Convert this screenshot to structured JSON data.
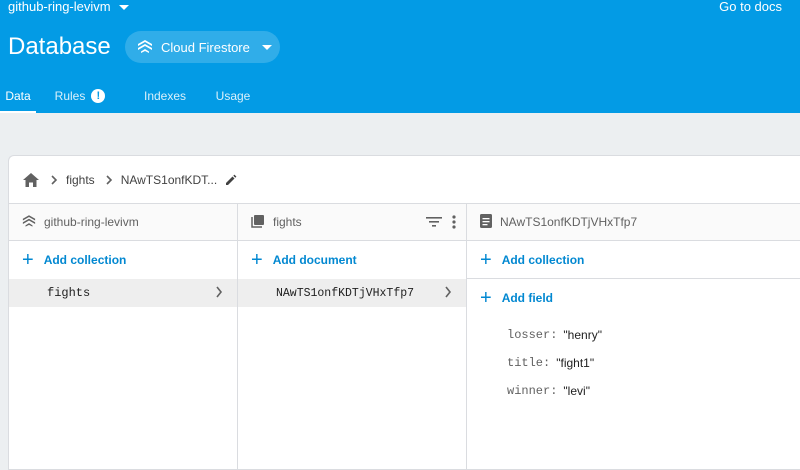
{
  "header": {
    "project_name": "github-ring-levivm",
    "docs_link": "Go to docs",
    "title": "Database",
    "db_selector": "Cloud Firestore"
  },
  "tabs": [
    {
      "label": "Data",
      "active": true
    },
    {
      "label": "Rules",
      "active": false,
      "badge": "!"
    },
    {
      "label": "Indexes",
      "active": false
    },
    {
      "label": "Usage",
      "active": false
    }
  ],
  "breadcrumb": {
    "items": [
      "fights",
      "NAwTS1onfKDT..."
    ]
  },
  "columns": {
    "root": {
      "title": "github-ring-levivm",
      "add_label": "Add collection",
      "items": [
        {
          "label": "fights",
          "selected": true
        }
      ]
    },
    "collection": {
      "title": "fights",
      "add_label": "Add document",
      "items": [
        {
          "label": "NAwTS1onfKDTjVHxTfp7",
          "selected": true
        }
      ]
    },
    "document": {
      "title": "NAwTS1onfKDTjVHxTfp7",
      "add_collection_label": "Add collection",
      "add_field_label": "Add field",
      "fields": [
        {
          "name": "losser:",
          "value": "\"henry\""
        },
        {
          "name": "title:",
          "value": "\"fight1\""
        },
        {
          "name": "winner:",
          "value": "\"levi\""
        }
      ]
    }
  },
  "colors": {
    "header_bg": "#039be5",
    "accent": "#0288d1",
    "page_bg": "#eceff1"
  }
}
